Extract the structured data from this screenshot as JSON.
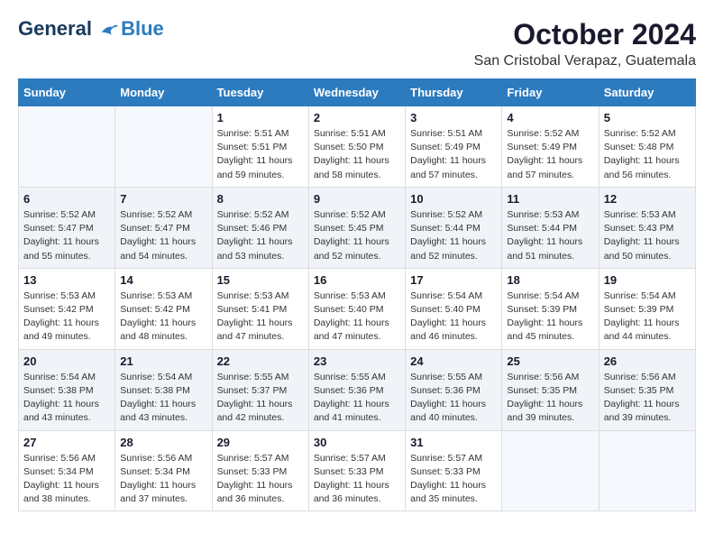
{
  "header": {
    "logo_line1": "General",
    "logo_line2": "Blue",
    "month_title": "October 2024",
    "location": "San Cristobal Verapaz, Guatemala"
  },
  "days_of_week": [
    "Sunday",
    "Monday",
    "Tuesday",
    "Wednesday",
    "Thursday",
    "Friday",
    "Saturday"
  ],
  "weeks": [
    [
      {
        "day": "",
        "info": ""
      },
      {
        "day": "",
        "info": ""
      },
      {
        "day": "1",
        "info": "Sunrise: 5:51 AM\nSunset: 5:51 PM\nDaylight: 11 hours\nand 59 minutes."
      },
      {
        "day": "2",
        "info": "Sunrise: 5:51 AM\nSunset: 5:50 PM\nDaylight: 11 hours\nand 58 minutes."
      },
      {
        "day": "3",
        "info": "Sunrise: 5:51 AM\nSunset: 5:49 PM\nDaylight: 11 hours\nand 57 minutes."
      },
      {
        "day": "4",
        "info": "Sunrise: 5:52 AM\nSunset: 5:49 PM\nDaylight: 11 hours\nand 57 minutes."
      },
      {
        "day": "5",
        "info": "Sunrise: 5:52 AM\nSunset: 5:48 PM\nDaylight: 11 hours\nand 56 minutes."
      }
    ],
    [
      {
        "day": "6",
        "info": "Sunrise: 5:52 AM\nSunset: 5:47 PM\nDaylight: 11 hours\nand 55 minutes."
      },
      {
        "day": "7",
        "info": "Sunrise: 5:52 AM\nSunset: 5:47 PM\nDaylight: 11 hours\nand 54 minutes."
      },
      {
        "day": "8",
        "info": "Sunrise: 5:52 AM\nSunset: 5:46 PM\nDaylight: 11 hours\nand 53 minutes."
      },
      {
        "day": "9",
        "info": "Sunrise: 5:52 AM\nSunset: 5:45 PM\nDaylight: 11 hours\nand 52 minutes."
      },
      {
        "day": "10",
        "info": "Sunrise: 5:52 AM\nSunset: 5:44 PM\nDaylight: 11 hours\nand 52 minutes."
      },
      {
        "day": "11",
        "info": "Sunrise: 5:53 AM\nSunset: 5:44 PM\nDaylight: 11 hours\nand 51 minutes."
      },
      {
        "day": "12",
        "info": "Sunrise: 5:53 AM\nSunset: 5:43 PM\nDaylight: 11 hours\nand 50 minutes."
      }
    ],
    [
      {
        "day": "13",
        "info": "Sunrise: 5:53 AM\nSunset: 5:42 PM\nDaylight: 11 hours\nand 49 minutes."
      },
      {
        "day": "14",
        "info": "Sunrise: 5:53 AM\nSunset: 5:42 PM\nDaylight: 11 hours\nand 48 minutes."
      },
      {
        "day": "15",
        "info": "Sunrise: 5:53 AM\nSunset: 5:41 PM\nDaylight: 11 hours\nand 47 minutes."
      },
      {
        "day": "16",
        "info": "Sunrise: 5:53 AM\nSunset: 5:40 PM\nDaylight: 11 hours\nand 47 minutes."
      },
      {
        "day": "17",
        "info": "Sunrise: 5:54 AM\nSunset: 5:40 PM\nDaylight: 11 hours\nand 46 minutes."
      },
      {
        "day": "18",
        "info": "Sunrise: 5:54 AM\nSunset: 5:39 PM\nDaylight: 11 hours\nand 45 minutes."
      },
      {
        "day": "19",
        "info": "Sunrise: 5:54 AM\nSunset: 5:39 PM\nDaylight: 11 hours\nand 44 minutes."
      }
    ],
    [
      {
        "day": "20",
        "info": "Sunrise: 5:54 AM\nSunset: 5:38 PM\nDaylight: 11 hours\nand 43 minutes."
      },
      {
        "day": "21",
        "info": "Sunrise: 5:54 AM\nSunset: 5:38 PM\nDaylight: 11 hours\nand 43 minutes."
      },
      {
        "day": "22",
        "info": "Sunrise: 5:55 AM\nSunset: 5:37 PM\nDaylight: 11 hours\nand 42 minutes."
      },
      {
        "day": "23",
        "info": "Sunrise: 5:55 AM\nSunset: 5:36 PM\nDaylight: 11 hours\nand 41 minutes."
      },
      {
        "day": "24",
        "info": "Sunrise: 5:55 AM\nSunset: 5:36 PM\nDaylight: 11 hours\nand 40 minutes."
      },
      {
        "day": "25",
        "info": "Sunrise: 5:56 AM\nSunset: 5:35 PM\nDaylight: 11 hours\nand 39 minutes."
      },
      {
        "day": "26",
        "info": "Sunrise: 5:56 AM\nSunset: 5:35 PM\nDaylight: 11 hours\nand 39 minutes."
      }
    ],
    [
      {
        "day": "27",
        "info": "Sunrise: 5:56 AM\nSunset: 5:34 PM\nDaylight: 11 hours\nand 38 minutes."
      },
      {
        "day": "28",
        "info": "Sunrise: 5:56 AM\nSunset: 5:34 PM\nDaylight: 11 hours\nand 37 minutes."
      },
      {
        "day": "29",
        "info": "Sunrise: 5:57 AM\nSunset: 5:33 PM\nDaylight: 11 hours\nand 36 minutes."
      },
      {
        "day": "30",
        "info": "Sunrise: 5:57 AM\nSunset: 5:33 PM\nDaylight: 11 hours\nand 36 minutes."
      },
      {
        "day": "31",
        "info": "Sunrise: 5:57 AM\nSunset: 5:33 PM\nDaylight: 11 hours\nand 35 minutes."
      },
      {
        "day": "",
        "info": ""
      },
      {
        "day": "",
        "info": ""
      }
    ]
  ]
}
